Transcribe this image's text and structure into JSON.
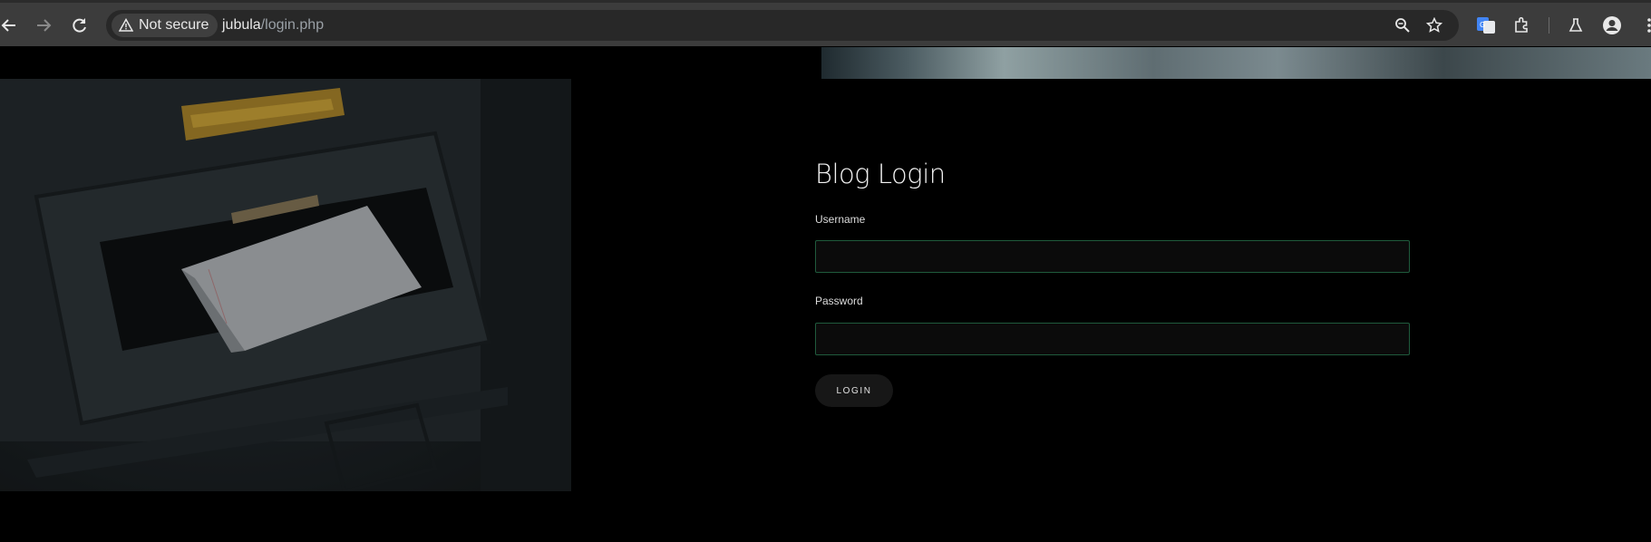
{
  "browser": {
    "security_label": "Not secure",
    "url_host": "jubula",
    "url_path": "/login.php"
  },
  "page": {
    "title": "Blog Login",
    "username_label": "Username",
    "username_value": "",
    "password_label": "Password",
    "password_value": "",
    "login_label": "LOGIN"
  },
  "colors": {
    "page_bg": "#000000",
    "input_border": "#1f5a3c",
    "toolbar_bg": "#3c3c3c"
  },
  "icons": [
    "back-arrow-icon",
    "forward-arrow-icon",
    "reload-icon",
    "warning-icon",
    "zoom-icon",
    "bookmark-star-icon",
    "translate-icon",
    "extensions-icon",
    "labs-flask-icon",
    "profile-icon",
    "menu-kebab-icon"
  ]
}
